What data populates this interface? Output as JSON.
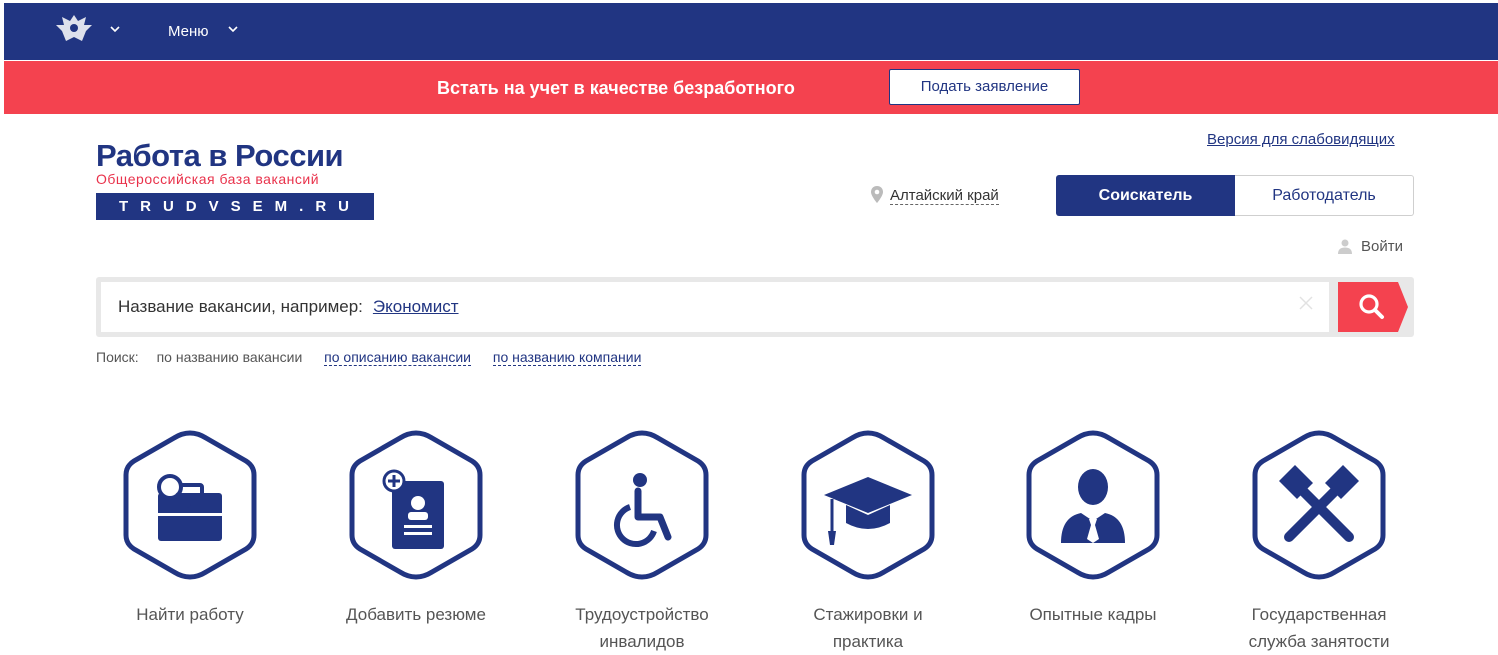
{
  "header": {
    "menu_label": "Меню"
  },
  "alert": {
    "text": "Встать на учет в качестве безработного",
    "button_label": "Подать заявление"
  },
  "logo": {
    "title": "Работа в России",
    "subtitle": "Общероссийская база вакансий",
    "domain": "TRUDVSEM.RU"
  },
  "accessibility_link": "Версия для слабовидящих",
  "location": "Алтайский край",
  "roles": {
    "seeker": "Соискатель",
    "employer": "Работодатель"
  },
  "login_label": "Войти",
  "search": {
    "placeholder_prefix": "Название вакансии, например:",
    "example": "Экономист",
    "modes_label": "Поиск:",
    "modes": [
      "по названию вакансии",
      "по описанию вакансии",
      "по названию компании"
    ]
  },
  "tiles": [
    {
      "label": "Найти работу",
      "icon": "briefcase-search-icon"
    },
    {
      "label": "Добавить резюме",
      "icon": "add-resume-icon"
    },
    {
      "label": "Трудоустройство инвалидов",
      "icon": "wheelchair-icon"
    },
    {
      "label": "Стажировки и практика",
      "icon": "graduation-cap-icon"
    },
    {
      "label": "Опытные кадры",
      "icon": "businessman-icon"
    },
    {
      "label": "Государственная служба занятости",
      "icon": "crossed-hammers-icon"
    }
  ],
  "colors": {
    "brand": "#213582",
    "accent": "#f4424f"
  }
}
